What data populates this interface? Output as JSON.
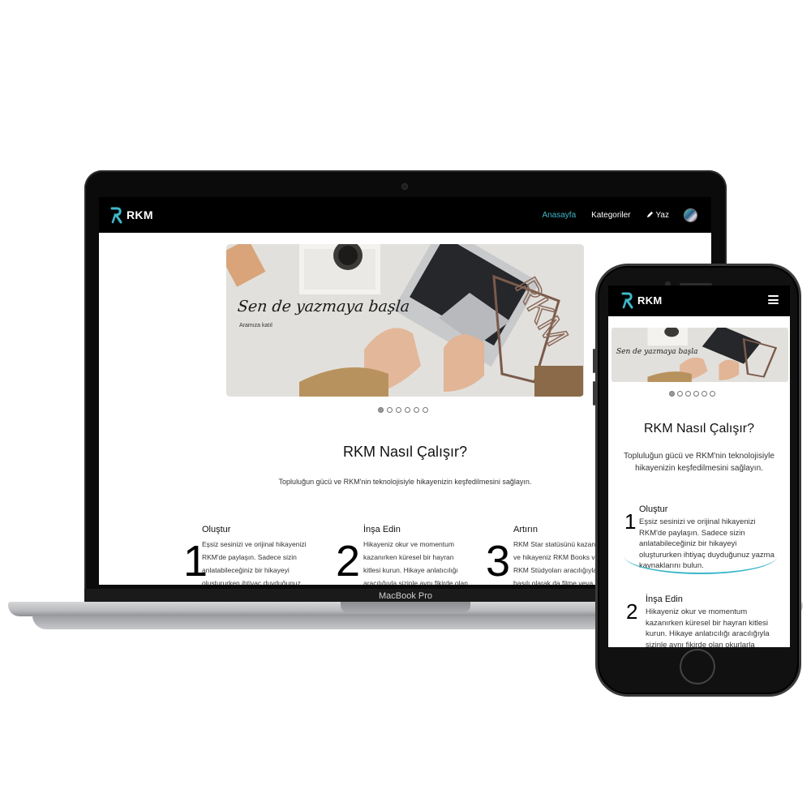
{
  "brand": {
    "logo_text": "RKM",
    "device_label": "MacBook Pro",
    "accent": "#3fb8c9"
  },
  "nav": {
    "home": "Anasayfa",
    "categories": "Kategoriler",
    "write": "Yaz",
    "write_icon": "pencil-icon",
    "menu_icon": "hamburger-icon"
  },
  "hero": {
    "headline": "Sen de yazmaya başla",
    "subline": "Aramıza katıl",
    "slides": 6,
    "active_slide": 1
  },
  "how": {
    "title": "RKM Nasıl Çalışır?",
    "subtitle": "Topluluğun gücü ve RKM'nin teknolojisiyle hikayenizin keşfedilmesini sağlayın.",
    "steps": [
      {
        "number": "1",
        "title": "Oluştur",
        "body": "Eşsiz sesinizi ve orijinal hikayenizi RKM'de paylaşın. Sadece sizin anlatabileceğiniz bir hikayeyi oluştururken ihtiyaç duyduğunuz yazma kaynaklarını bulun."
      },
      {
        "number": "2",
        "title": "İnşa Edin",
        "body": "Hikayeniz okur ve momentum kazanırken küresel bir hayran kitlesi kurun. Hikaye anlatıcılığı aracılığıyla sizinle aynı fikirde olan okurlarla bağlantı kurun."
      },
      {
        "number": "3",
        "title": "Artırın",
        "body": "RKM Star statüsünü kazanın ve hikayeniz RKM Books ve RKM Stüdyoları aracılığıyla basılı olarak da filme veya televizyon dizisine dönüşebilir."
      }
    ]
  }
}
